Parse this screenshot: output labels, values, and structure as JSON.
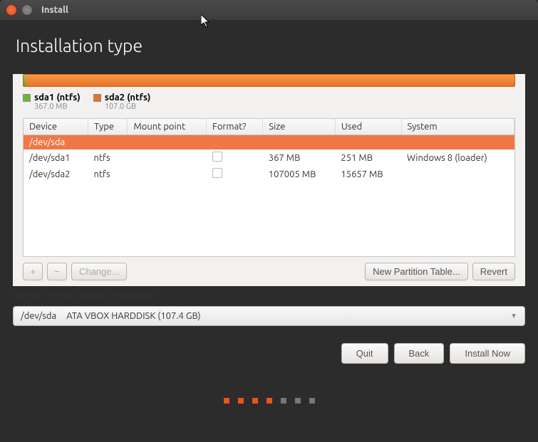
{
  "window": {
    "title": "Install"
  },
  "header": {
    "title": "Installation type"
  },
  "legend": [
    {
      "label": "sda1 (ntfs)",
      "size": "367.0 MB",
      "color": "#6ab82f"
    },
    {
      "label": "sda2 (ntfs)",
      "size": "107.0 GB",
      "color": "#e77326"
    }
  ],
  "columns": {
    "device": "Device",
    "type": "Type",
    "mount": "Mount point",
    "format": "Format?",
    "size": "Size",
    "used": "Used",
    "system": "System"
  },
  "rows": [
    {
      "kind": "disk",
      "device": "/dev/sda"
    },
    {
      "kind": "part",
      "device": "/dev/sda1",
      "type": "ntfs",
      "mount": "",
      "format": false,
      "size": "367 MB",
      "used": "251 MB",
      "system": "Windows 8 (loader)"
    },
    {
      "kind": "part",
      "device": "/dev/sda2",
      "type": "ntfs",
      "mount": "",
      "format": false,
      "size": "107005 MB",
      "used": "15657 MB",
      "system": ""
    }
  ],
  "toolbar": {
    "add": "+",
    "remove": "−",
    "change": "Change...",
    "newtable": "New Partition Table...",
    "revert": "Revert"
  },
  "boot": {
    "label": "Device for boot loader installation:",
    "value_dev": "/dev/sda",
    "value_desc": "ATA VBOX HARDDISK (107.4 GB)"
  },
  "footer": {
    "quit": "Quit",
    "back": "Back",
    "install": "Install Now"
  },
  "dots": {
    "total": 7,
    "active": 4
  }
}
